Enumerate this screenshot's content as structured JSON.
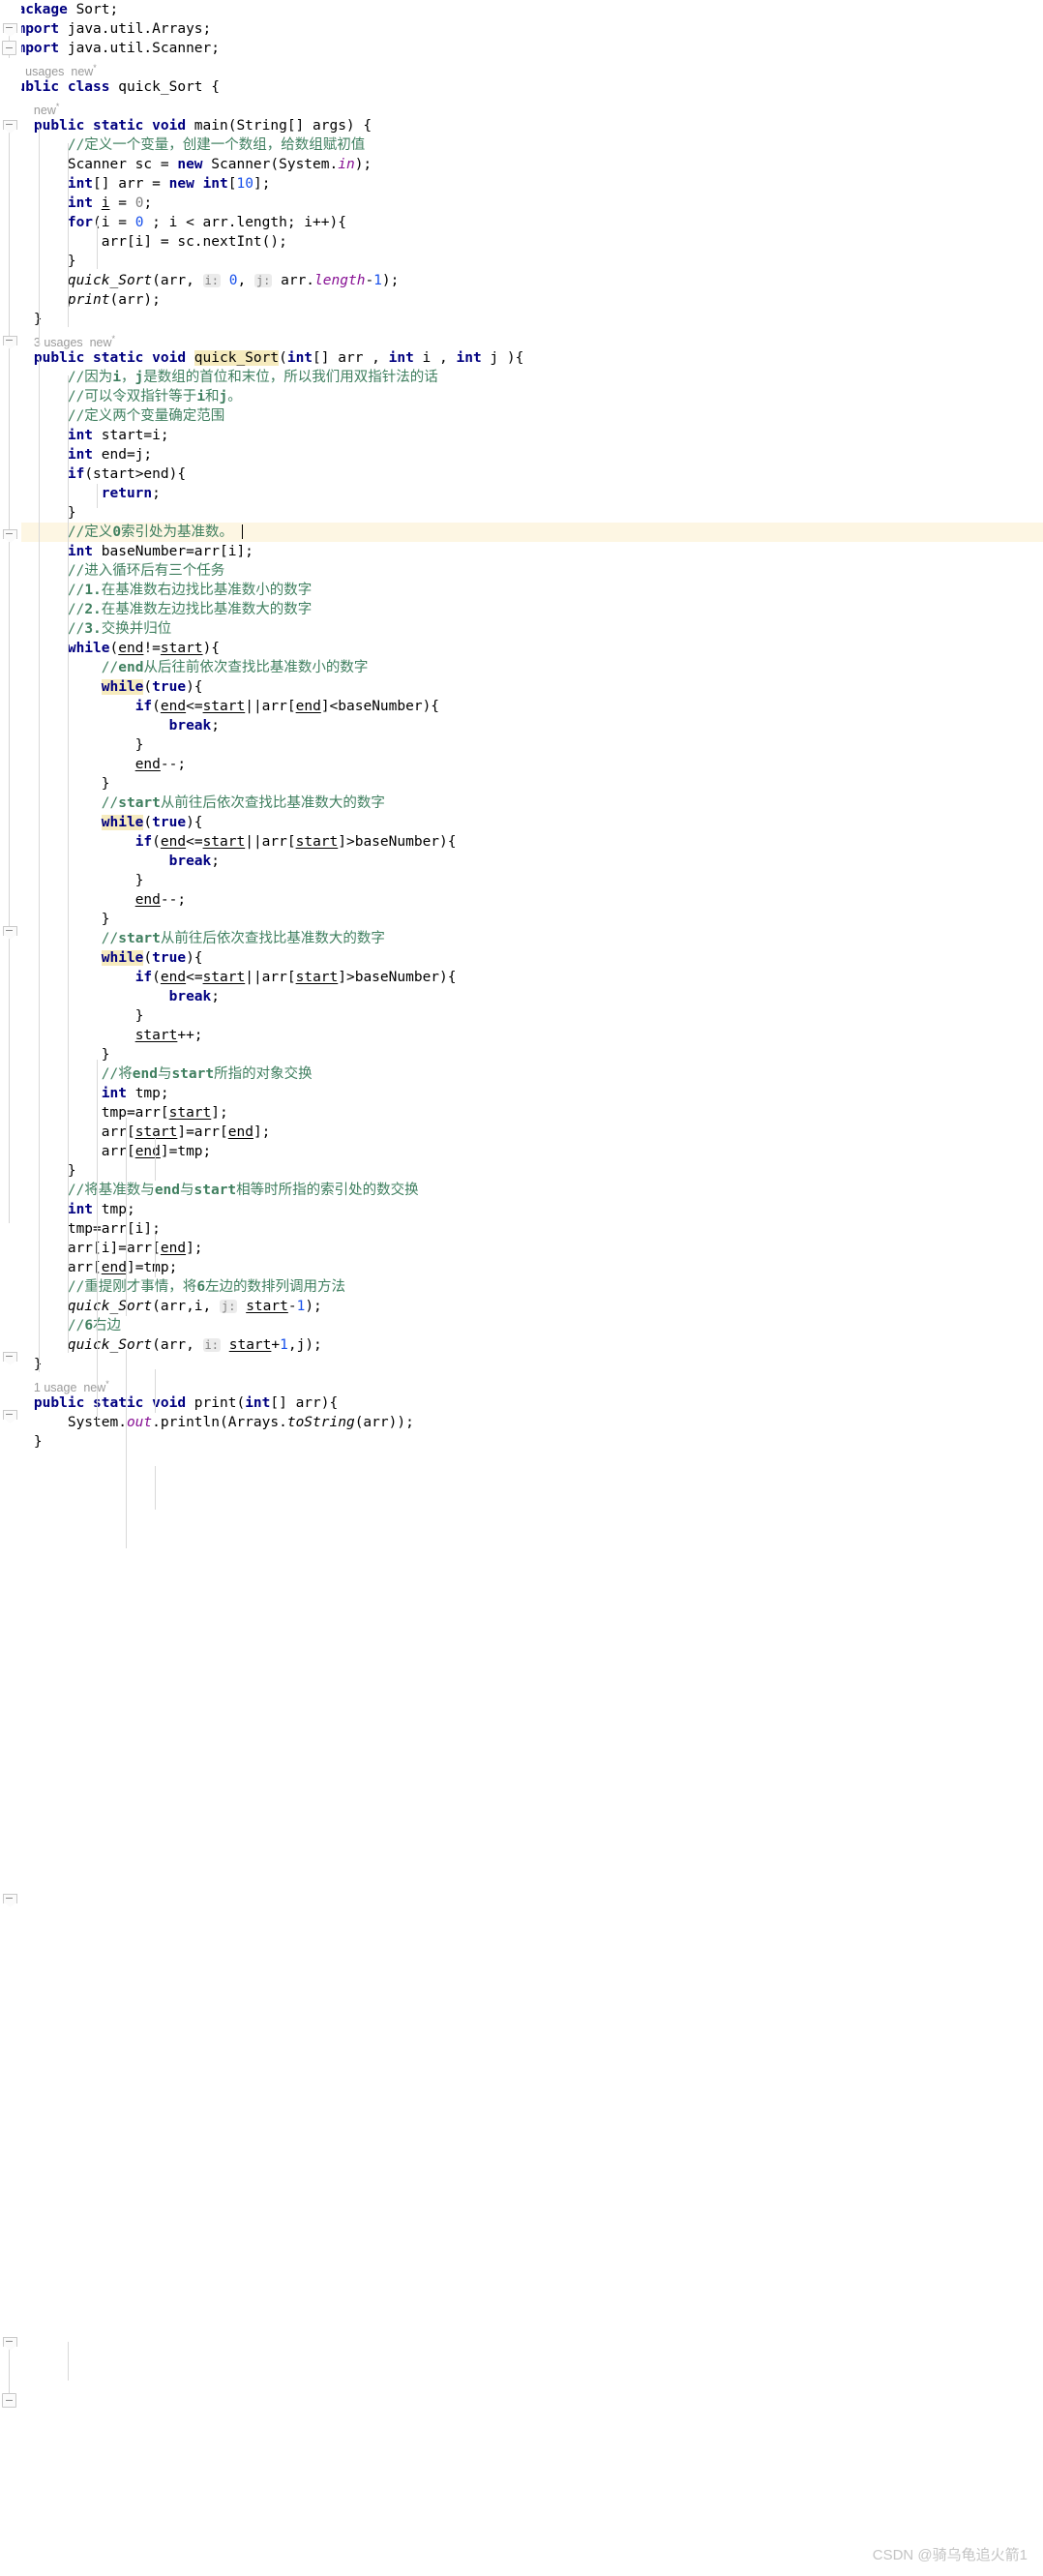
{
  "editor": {
    "language": "Java",
    "watermark": "CSDN @骑乌龟追火箭1",
    "caret_line_index": 44,
    "colors": {
      "keyword": "#000080",
      "comment": "#3f7f5f",
      "number": "#1750eb",
      "static_field": "#871094",
      "caret_line_bg": "#fdf6e3",
      "identifier_highlight": "#f6ebbe",
      "inlay_bg": "#ebebeb",
      "background": "#ffffff",
      "watermark": "#c4c4c4"
    },
    "code_vision": [
      {
        "line": 3,
        "text": "no usages",
        "new": "new *"
      },
      {
        "line": 5,
        "text": "",
        "new": "new *"
      },
      {
        "line": 16,
        "text": "3 usages",
        "new": "new *"
      },
      {
        "line": 67,
        "text": "1 usage",
        "new": "new *"
      }
    ],
    "inlay_hints": [
      "i:",
      "j:"
    ],
    "lines": [
      "package Sort;",
      "import java.util.Arrays;",
      "import java.util.Scanner;",
      "no usages   new *",
      "public class quick_Sort {",
      "    new *",
      "    public static void main(String[] args) {",
      "        //定义一个变量，创建一个数组，给数组赋初值",
      "        Scanner sc = new Scanner(System.in);",
      "        int[] arr = new int[10];",
      "        int i = 0;",
      "        for(i = 0 ; i < arr.length; i++){",
      "            arr[i] = sc.nextInt();",
      "        }",
      "        quick_Sort(arr, i: 0, j: arr.length-1);",
      "        print(arr);",
      "    }",
      "    3 usages   new *",
      "    public static void quick_Sort(int[] arr , int i , int j ){",
      "        //因为i，j是数组的首位和末位，所以我们用双指针法的话",
      "        //可以令双指针等于i和j。",
      "        //定义两个变量确定范围",
      "        int start=i;",
      "        int end=j;",
      "        if(start>end){",
      "            return;",
      "        }",
      "        //定义0索引处为基准数。",
      "        int baseNumber=arr[i];",
      "        //进入循环后有三个任务",
      "        //1.在基准数右边找比基准数小的数字",
      "        //2.在基准数左边找比基准数大的数字",
      "        //3.交换并归位",
      "        while(end!=start){",
      "            //end从后往前依次查找比基准数小的数字",
      "            while(true){",
      "                if(end<=start||arr[end]<baseNumber){",
      "                    break;",
      "                }",
      "                end--;",
      "            }",
      "            //start从前往后依次查找比基准数大的数字",
      "            while(true){",
      "                if(end<=start||arr[start]>baseNumber){",
      "                    break;",
      "                }",
      "                end--;",
      "            }",
      "            //start从前往后依次查找比基准数大的数字",
      "            while(true){",
      "                if(end<=start||arr[start]>baseNumber){",
      "                    break;",
      "                }",
      "                start++;",
      "            }",
      "            //将end与start所指的对象交换",
      "            int tmp;",
      "            tmp=arr[start];",
      "            arr[start]=arr[end];",
      "            arr[end]=tmp;",
      "        }",
      "        //将基准数与end与start相等时所指的索引处的数交换",
      "        int tmp;",
      "        tmp=arr[i];",
      "        arr[i]=arr[end];",
      "        arr[end]=tmp;",
      "        //重提刚才事情，将6左边的数排列调用方法",
      "        quick_Sort(arr,i, j: start-1);",
      "        //6右边",
      "        quick_Sort(arr, i: start+1,j);",
      "    }",
      "    1 usage   new *",
      "    public static void print(int[] arr){",
      "        System.out.println(Arrays.toString(arr));",
      "    }",
      "}"
    ]
  }
}
